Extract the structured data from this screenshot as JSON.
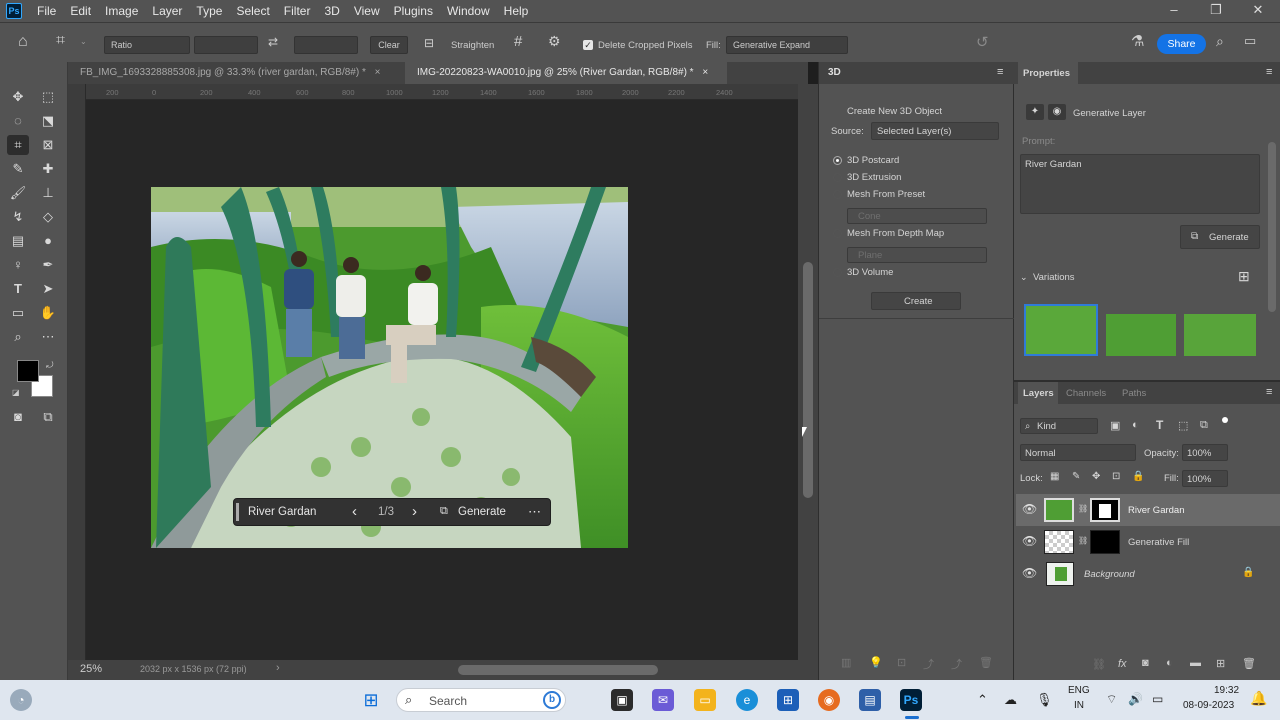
{
  "menubar": {
    "logo": "Ps",
    "items": [
      "File",
      "Edit",
      "Image",
      "Layer",
      "Type",
      "Select",
      "Filter",
      "3D",
      "View",
      "Plugins",
      "Window",
      "Help"
    ],
    "window_controls": [
      "–",
      "❐",
      "✕"
    ]
  },
  "options": {
    "ratio_value": "Ratio",
    "clear_label": "Clear",
    "straighten_label": "Straighten",
    "delete_cropped_label": "Delete Cropped Pixels",
    "fill_label": "Fill:",
    "fill_value": "Generative Expand",
    "share_label": "Share"
  },
  "doc_tabs": [
    {
      "label": "FB_IMG_1693328885308.jpg @ 33.3% (river gardan, RGB/8#) *",
      "close": "×"
    },
    {
      "label": "IMG-20220823-WA0010.jpg @ 25% (River Gardan, RGB/8#) *",
      "close": "×"
    }
  ],
  "ruler": {
    "ticks": [
      "200",
      "0",
      "200",
      "400",
      "600",
      "800",
      "1000",
      "1200",
      "1400",
      "1600",
      "1800",
      "2000",
      "2200",
      "2400"
    ]
  },
  "status": {
    "zoom": "25%",
    "doc_info": "2032 px x 1536 px (72 ppi)",
    "arrow": "›"
  },
  "context_bar": {
    "prompt": "River Gardan",
    "prev": "‹",
    "counter": "1/3",
    "next": "›",
    "generate": "Generate",
    "more": "⋯"
  },
  "panel3d": {
    "tab": "3D",
    "header": "Create New 3D Object",
    "source_label": "Source:",
    "source_value": "Selected Layer(s)",
    "options": [
      "3D Postcard",
      "3D Extrusion",
      "Mesh From Preset",
      "Mesh From Depth Map",
      "3D Volume"
    ],
    "preset_value": "Cone",
    "depth_value": "Plane",
    "create_label": "Create"
  },
  "properties": {
    "tab": "Properties",
    "layer_type": "Generative Layer",
    "prompt_label": "Prompt:",
    "prompt_value": "River Gardan",
    "generate_label": "Generate",
    "variations_label": "Variations"
  },
  "layers": {
    "tabs": [
      "Layers",
      "Channels",
      "Paths"
    ],
    "kind_value": "Kind",
    "blend_mode": "Normal",
    "opacity_label": "Opacity:",
    "opacity_value": "100%",
    "lock_label": "Lock:",
    "fill_label": "Fill:",
    "fill_value": "100%",
    "rows": [
      {
        "name": "River Gardan"
      },
      {
        "name": "Generative Fill"
      },
      {
        "name": "Background"
      }
    ]
  },
  "taskbar": {
    "search_placeholder": "Search",
    "lang_top": "ENG",
    "lang_bottom": "IN",
    "time": "19:32",
    "date": "08-09-2023"
  },
  "colors": {
    "accent": "#1473e6",
    "panel": "#535353",
    "canvas": "#262626"
  }
}
